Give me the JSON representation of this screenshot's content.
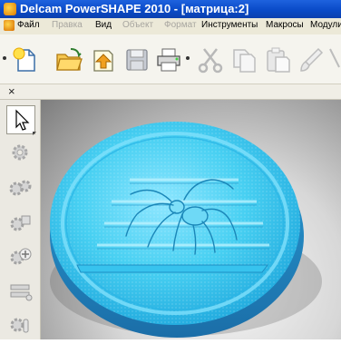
{
  "window": {
    "title": "Delcam PowerSHAPE 2010 - [матрица:2]"
  },
  "menu": {
    "items": [
      {
        "label": "Файл",
        "enabled": true
      },
      {
        "label": "Правка",
        "enabled": false
      },
      {
        "label": "Вид",
        "enabled": true
      },
      {
        "label": "Объект",
        "enabled": false
      },
      {
        "label": "Формат",
        "enabled": false
      },
      {
        "label": "Инструменты",
        "enabled": true
      },
      {
        "label": "Макросы",
        "enabled": true
      },
      {
        "label": "Модули",
        "enabled": true
      }
    ]
  },
  "toolbar": {
    "icons": [
      "new-file-icon",
      "open-folder-icon",
      "import-icon",
      "save-icon",
      "print-icon",
      "cut-icon",
      "copy-icon",
      "paste-icon",
      "brush-icon",
      "scissors-icon"
    ]
  },
  "palette": {
    "close_glyph": "×"
  },
  "sidebar": {
    "tools": [
      "select-arrow-icon",
      "gear-tool-icon",
      "gear-tool-icon",
      "gear-tool-icon",
      "gear-add-icon",
      "toolbar-tool-icon",
      "gear-tool-icon"
    ]
  },
  "colors": {
    "model": "#4fd2f0",
    "titlebar": "#0a4bc8",
    "background": "#d7d7d7"
  }
}
